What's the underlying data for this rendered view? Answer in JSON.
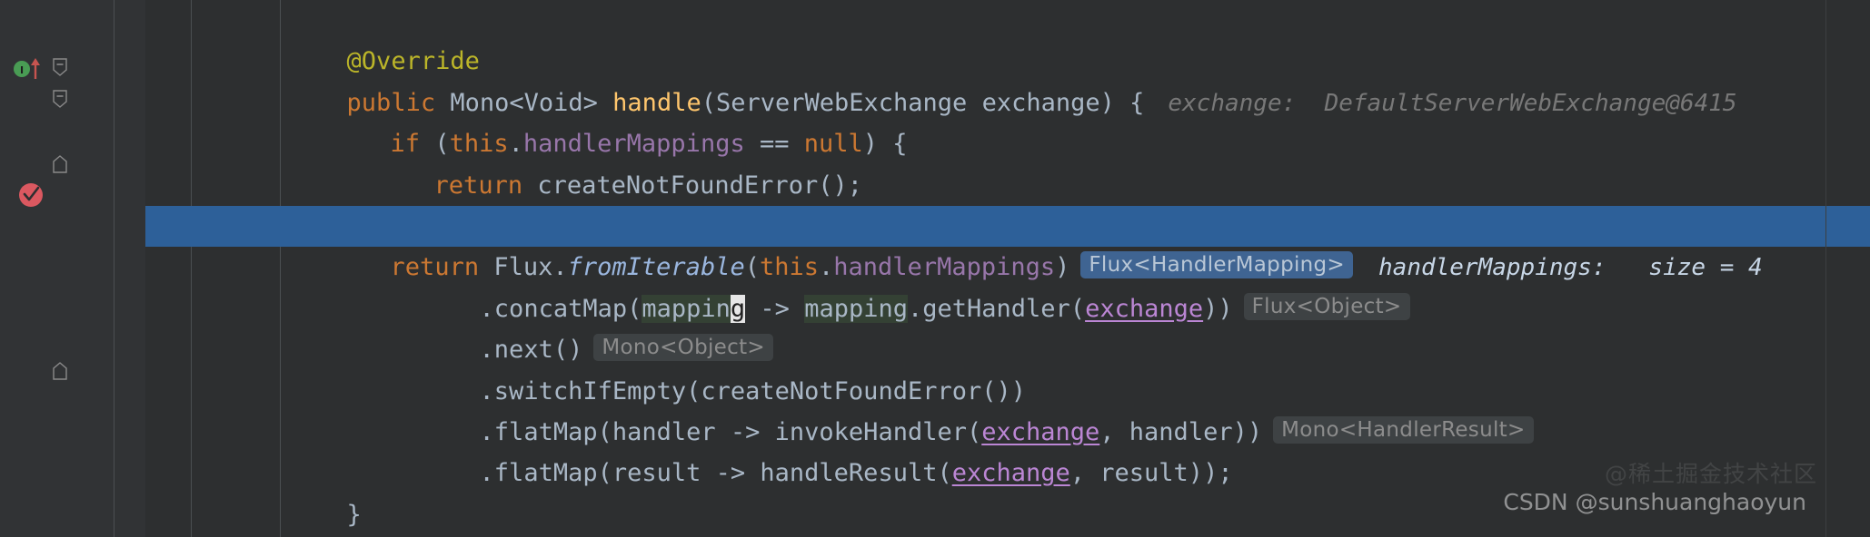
{
  "editor": {
    "theme": "darcula",
    "background": "#2d2f30",
    "gutter_background": "#313335",
    "current_line_color": "#2d6099",
    "default_text_color": "#a9b7c6"
  },
  "gutter": {
    "line_numbers": [
      "",
      "",
      "",
      "",
      "",
      "",
      "",
      "",
      "",
      "",
      "",
      "",
      ""
    ],
    "icons": [
      {
        "name": "method-override-arrow-icon",
        "label": "I",
        "row": 1,
        "color": "#499c54"
      },
      {
        "name": "breakpoint-verified-icon",
        "label": "",
        "row": 4,
        "color": "#db5860"
      }
    ],
    "fold_markers": [
      {
        "name": "fold-collapse-icon",
        "row": 1,
        "type": "minus"
      },
      {
        "name": "fold-collapse-icon",
        "row": 2,
        "type": "minus"
      },
      {
        "name": "fold-end-icon",
        "row": 3,
        "type": "end"
      },
      {
        "name": "fold-end-icon",
        "row": 11,
        "type": "end"
      }
    ]
  },
  "code": {
    "language": "java",
    "lines": [
      {
        "id": "line-annotation",
        "indent": 0,
        "text": "@Override",
        "tokens": [
          {
            "t": "@Override",
            "c": "anno"
          }
        ]
      },
      {
        "id": "line-method-signature",
        "indent": 0,
        "text": "public Mono<Void> handle(ServerWebExchange exchange) {",
        "inline_hint": "exchange:  DefaultServerWebExchange@6415"
      },
      {
        "id": "line-if-null-check",
        "indent": 1,
        "text": "if (this.handlerMappings == null) {"
      },
      {
        "id": "line-return-not-found",
        "indent": 2,
        "text": "return createNotFoundError();"
      },
      {
        "id": "line-close-if",
        "indent": 1,
        "text": "}"
      },
      {
        "id": "line-return-flux",
        "indent": 1,
        "current": true,
        "text": "return Flux.fromIterable(this.handlerMappings)",
        "chip": "Flux<HandlerMapping>",
        "debug_value": "handlerMappings:   size = 4"
      },
      {
        "id": "line-concat-map",
        "indent": 3,
        "text": ".concatMap(mapping -> mapping.getHandler(exchange))",
        "chip": "Flux<Object>",
        "cursor_after": "mapping"
      },
      {
        "id": "line-next",
        "indent": 3,
        "text": ".next()",
        "chip": "Mono<Object>"
      },
      {
        "id": "line-switch-if-empty",
        "indent": 3,
        "text": ".switchIfEmpty(createNotFoundError())"
      },
      {
        "id": "line-flatmap-invoke-handler",
        "indent": 3,
        "text": ".flatMap(handler -> invokeHandler(exchange, handler))",
        "chip": "Mono<HandlerResult>"
      },
      {
        "id": "line-flatmap-handle-result",
        "indent": 3,
        "text": ".flatMap(result -> handleResult(exchange, result));"
      },
      {
        "id": "line-close-method",
        "indent": 0,
        "text": "}"
      }
    ],
    "tokens": {
      "line_annotation": [
        {
          "s": "@Override",
          "c": "anno"
        }
      ],
      "line_method_signature": [
        {
          "s": "public",
          "c": "kw"
        },
        {
          "s": " Mono<Void> ",
          "c": "plain"
        },
        {
          "s": "handle",
          "c": "fn"
        },
        {
          "s": "(ServerWebExchange exchange) {",
          "c": "plain"
        }
      ],
      "line_if_null_check": [
        {
          "s": "if",
          "c": "kw"
        },
        {
          "s": " (",
          "c": "plain"
        },
        {
          "s": "this",
          "c": "kw"
        },
        {
          "s": ".",
          "c": "plain"
        },
        {
          "s": "handlerMappings",
          "c": "field"
        },
        {
          "s": " == ",
          "c": "plain"
        },
        {
          "s": "null",
          "c": "kw"
        },
        {
          "s": ") {",
          "c": "plain"
        }
      ],
      "line_return_not_found": [
        {
          "s": "return",
          "c": "kw"
        },
        {
          "s": " createNotFoundError();",
          "c": "plain"
        }
      ],
      "line_return_flux": [
        {
          "s": "return",
          "c": "kw"
        },
        {
          "s": " Flux.",
          "c": "plain"
        },
        {
          "s": "fromIterable",
          "c": "stat"
        },
        {
          "s": "(",
          "c": "plain"
        },
        {
          "s": "this",
          "c": "kw"
        },
        {
          "s": ".",
          "c": "plain"
        },
        {
          "s": "handlerMappings",
          "c": "field"
        },
        {
          "s": ")",
          "c": "plain"
        }
      ]
    }
  },
  "watermarks": {
    "chinese": "@稀土掘金技术社区",
    "csdn": "CSDN @sunshuanghaoyun"
  }
}
